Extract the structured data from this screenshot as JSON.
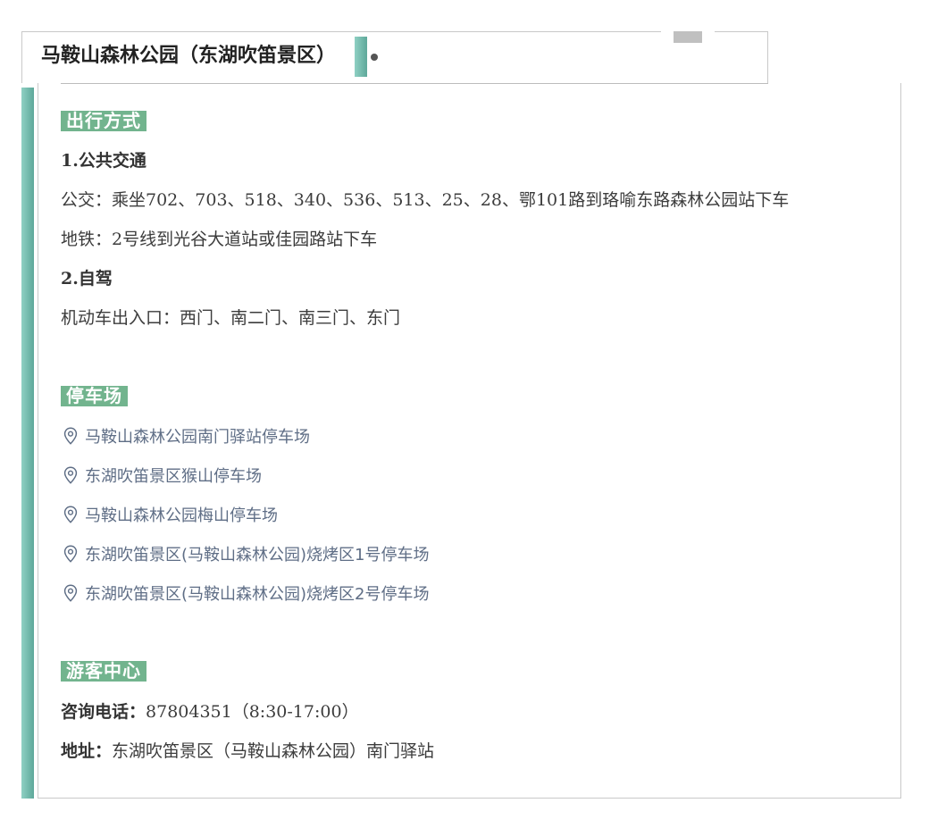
{
  "title": "马鞍山森林公园（东湖吹笛景区）",
  "colors": {
    "accent_gradient_start": "#8fd0c3",
    "accent_gradient_end": "#5ea89a",
    "tag_bg": "#72b48e",
    "park_text": "#5f6e86"
  },
  "transport": {
    "heading": "出行方式",
    "public_title": "1.公共交通",
    "bus": "公交：乘坐702、703、518、340、536、513、25、28、鄂101路到珞喻东路森林公园站下车",
    "metro": "地铁：2号线到光谷大道站或佳园路站下车",
    "drive_title": "2.自驾",
    "entrances": "机动车出入口：西门、南二门、南三门、东门"
  },
  "parking": {
    "heading": "停车场",
    "icon": "location-pin-icon",
    "items": [
      "马鞍山森林公园南门驿站停车场",
      "东湖吹笛景区猴山停车场",
      "马鞍山森林公园梅山停车场",
      "东湖吹笛景区(马鞍山森林公园)烧烤区1号停车场",
      "东湖吹笛景区(马鞍山森林公园)烧烤区2号停车场"
    ]
  },
  "visitor": {
    "heading": "游客中心",
    "phone_label": "咨询电话：",
    "phone_value": "87804351（8:30-17:00）",
    "address_label": "地址：",
    "address_value": "东湖吹笛景区（马鞍山森林公园）南门驿站"
  }
}
